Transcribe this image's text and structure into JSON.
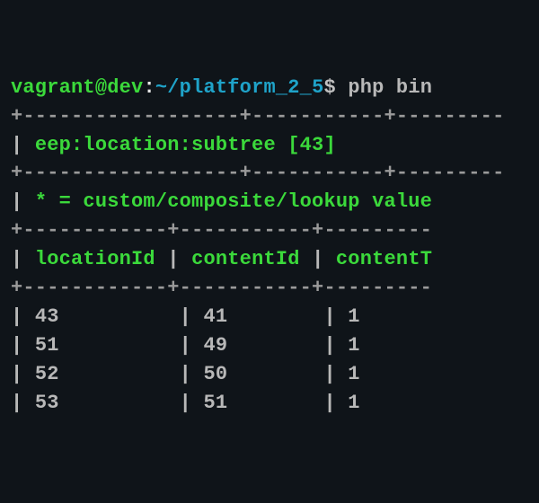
{
  "prompt": {
    "user": "vagrant",
    "at": "@",
    "host": "dev",
    "sep": ":",
    "path": "~/platform_2_5",
    "dollar": "$",
    "command": "php bin"
  },
  "border1": "+------------------+-----------+---------",
  "header1_lead": "| ",
  "header1_text": "eep:location:subtree [43]",
  "border2": "+------------------+-----------+---------",
  "header2_lead": "| ",
  "header2_text": "* = custom/composite/lookup value",
  "border3": "+------------+-----------+---------",
  "col_lead1": "| ",
  "col1": "locationId",
  "col_sep": " | ",
  "col2": "contentId",
  "col3": "contentT",
  "border4": "+------------+-----------+---------",
  "rows": [
    {
      "c1": "43",
      "c2": "41",
      "c3": "1"
    },
    {
      "c1": "51",
      "c2": "49",
      "c3": "1"
    },
    {
      "c1": "52",
      "c2": "50",
      "c3": "1"
    },
    {
      "c1": "53",
      "c2": "51",
      "c3": "1"
    }
  ],
  "row_tpl": {
    "p1": "| ",
    "pad1": "          | ",
    "pad2": "        | ",
    "pad3": ""
  }
}
